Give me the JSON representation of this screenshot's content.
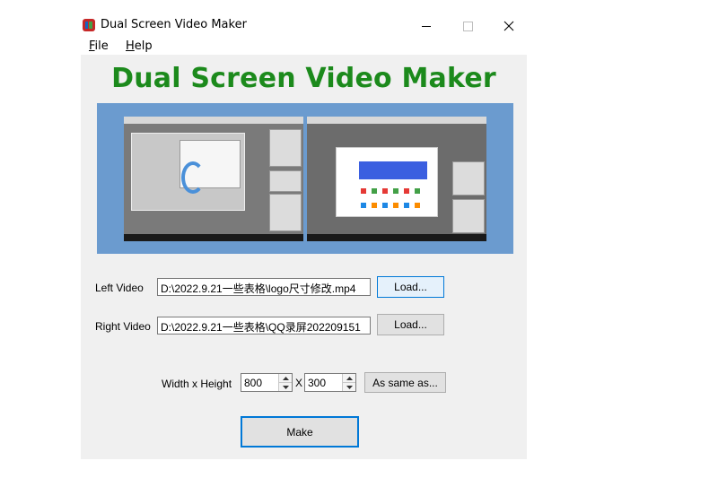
{
  "window": {
    "title": "Dual Screen Video Maker",
    "icon": "app-icon"
  },
  "menu": {
    "file": {
      "accel": "F",
      "rest": "ile"
    },
    "help": {
      "accel": "H",
      "rest": "elp"
    }
  },
  "main": {
    "heading": "Dual Screen Video Maker",
    "heading_color": "#1c8a1c",
    "left_video": {
      "label": "Left Video",
      "path": "D:\\2022.9.21一些表格\\logo尺寸修改.mp4",
      "load_label": "Load..."
    },
    "right_video": {
      "label": "Right Video",
      "path": "D:\\2022.9.21一些表格\\QQ录屏202209151",
      "load_label": "Load..."
    },
    "size": {
      "label": "Width x Height",
      "width": "800",
      "separator": "X",
      "height": "300",
      "same_as_label": "As same as..."
    },
    "make_label": "Make"
  }
}
